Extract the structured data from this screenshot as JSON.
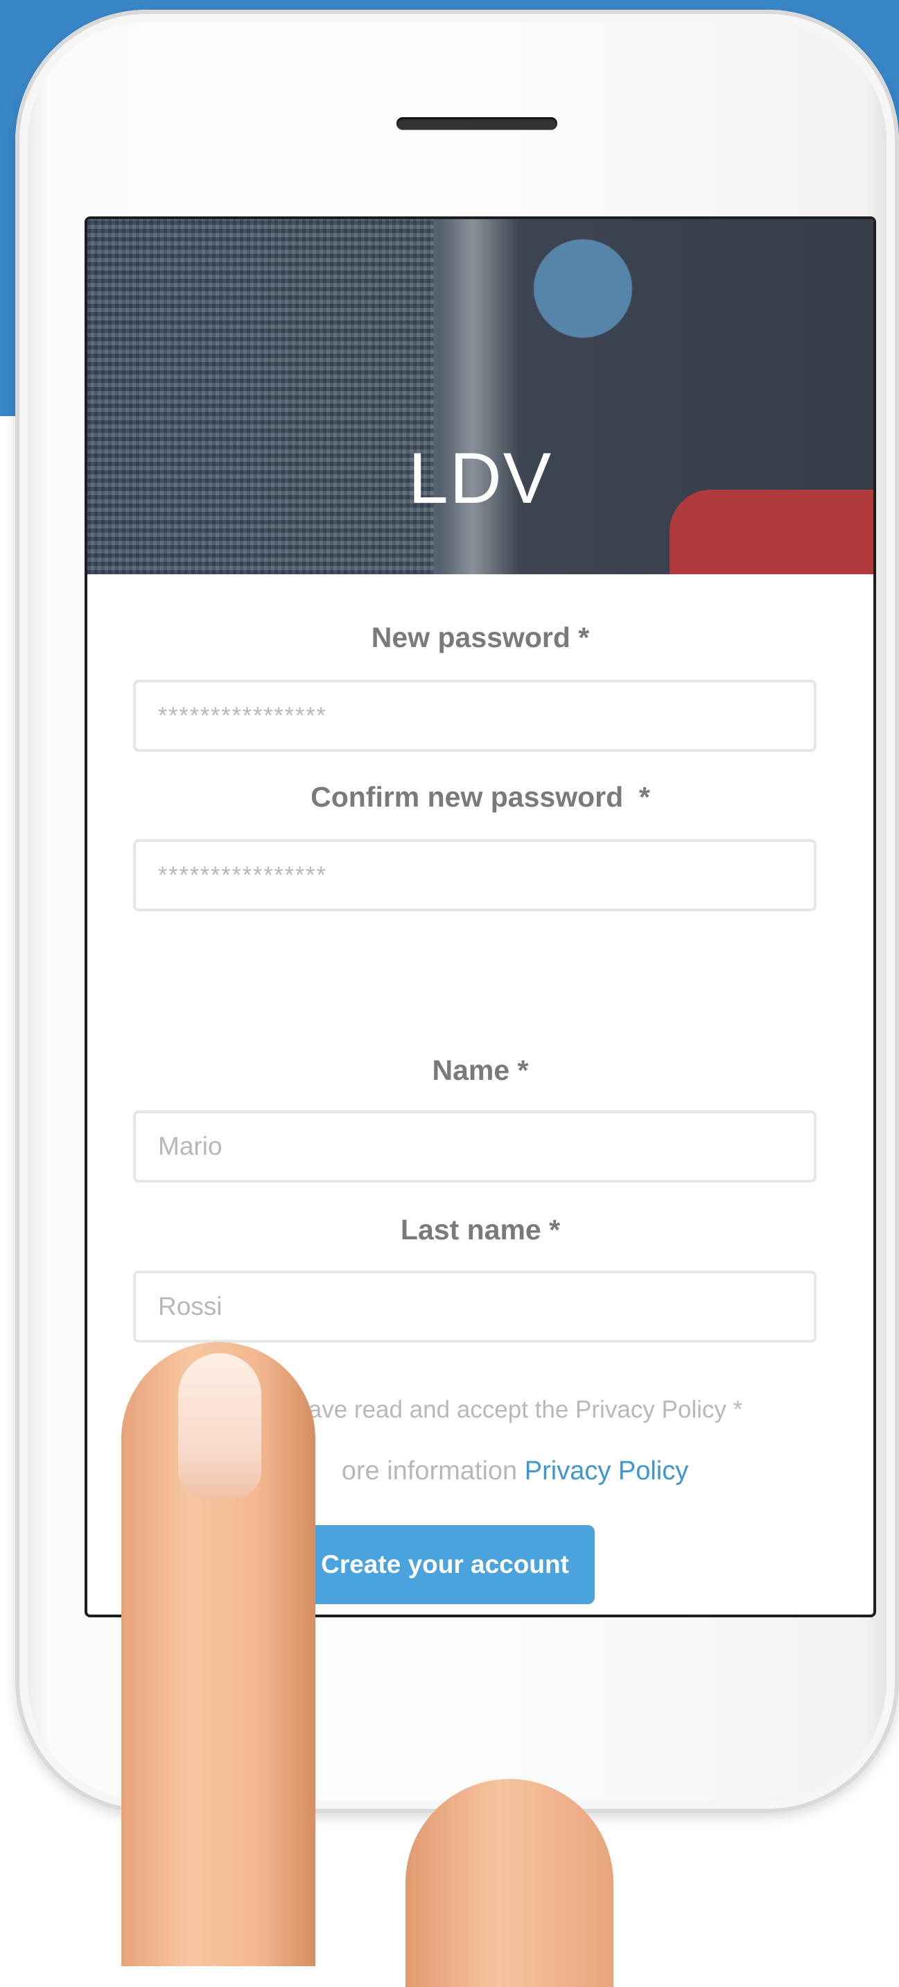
{
  "app": {
    "title": "LDV"
  },
  "form": {
    "new_password": {
      "label": "New password *",
      "placeholder": "****************"
    },
    "confirm_password": {
      "label": "Confirm new password  *",
      "placeholder": "****************"
    },
    "name": {
      "label": "Name *",
      "placeholder": "Mario"
    },
    "last_name": {
      "label": "Last name *",
      "placeholder": "Rossi"
    },
    "privacy_accept_text": "ave read and accept the Privacy Policy *",
    "privacy_info_text": "ore information ",
    "privacy_link": "Privacy Policy",
    "submit_label": "Create your account"
  },
  "colors": {
    "accent": "#4aa3dc",
    "link": "#3f96d2",
    "background_blue": "#3a87c8",
    "label": "#7a7a7a"
  }
}
